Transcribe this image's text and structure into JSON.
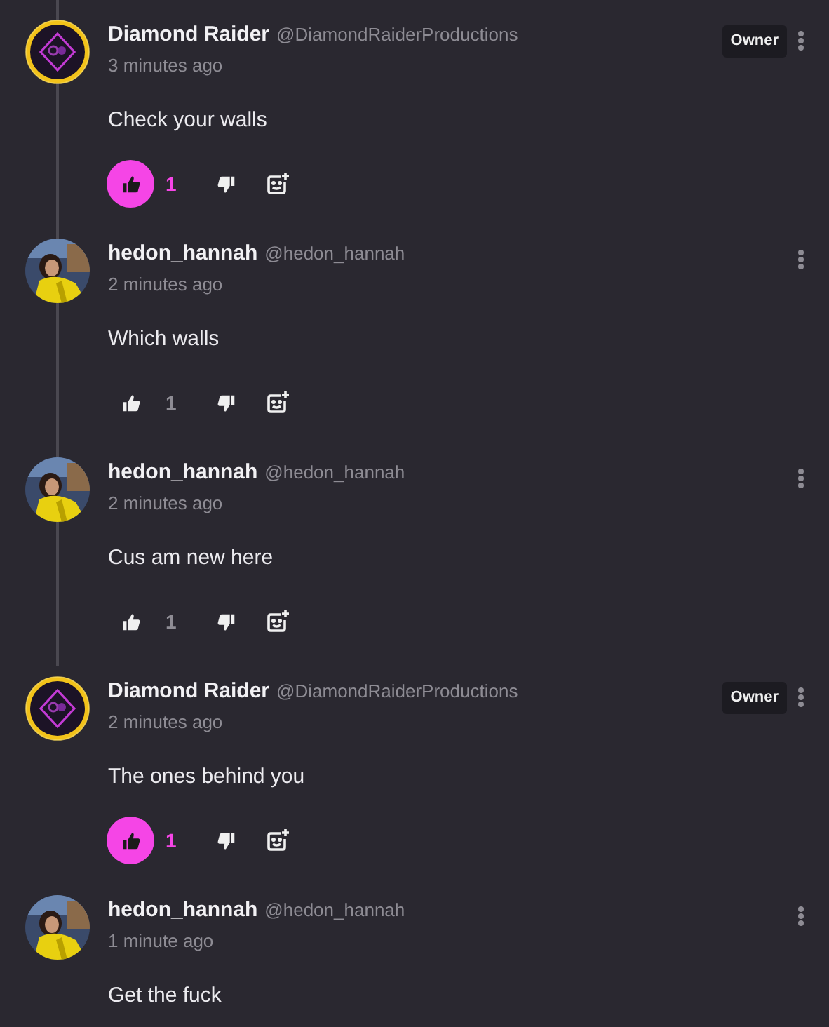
{
  "comments": [
    {
      "author": "Diamond Raider",
      "handle": "@DiamondRaiderProductions",
      "time": "3 minutes ago",
      "badge": "Owner",
      "avatar": {
        "kind": "logo"
      },
      "text": "Check your walls",
      "like": {
        "selected": true,
        "count": "1"
      }
    },
    {
      "author": "hedon_hannah",
      "handle": "@hedon_hannah",
      "time": "2 minutes ago",
      "text": "Which walls",
      "like": {
        "selected": false,
        "count": "1"
      }
    },
    {
      "author": "hedon_hannah",
      "handle": "@hedon_hannah",
      "time": "2 minutes ago",
      "text": "Cus am new here",
      "like": {
        "selected": false,
        "count": "1"
      }
    },
    {
      "author": "Diamond Raider",
      "handle": "@DiamondRaiderProductions",
      "time": "2 minutes ago",
      "badge": "Owner",
      "avatar": {
        "kind": "logo"
      },
      "text": "The ones behind you",
      "like": {
        "selected": true,
        "count": "1"
      }
    },
    {
      "author": "hedon_hannah",
      "handle": "@hedon_hannah",
      "time": "1 minute ago",
      "text": "Get the fuck"
    }
  ]
}
